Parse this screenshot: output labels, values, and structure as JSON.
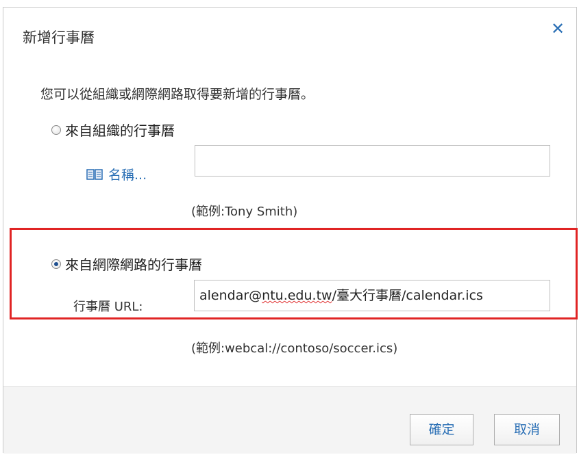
{
  "dialog": {
    "title": "新增行事曆",
    "close_symbol": "✕"
  },
  "intro_text": "您可以從組織或網際網路取得要新增的行事曆。",
  "org_option": {
    "label": "來自組織的行事曆",
    "checked": false,
    "names_button_label": "名稱...",
    "names_icon": "address-book-icon",
    "name_input_value": "",
    "example": "(範例:Tony Smith)"
  },
  "internet_option": {
    "label": "來自網際網路的行事曆",
    "checked": true,
    "url_label": "行事曆 URL:",
    "url_value_part1": "alendar@",
    "url_value_part2": "ntu.edu.tw",
    "url_value_part3": "/臺大行事曆/calendar.ics",
    "example": "(範例:webcal://contoso/soccer.ics)"
  },
  "buttons": {
    "ok_label": "確定",
    "cancel_label": "取消"
  },
  "colors": {
    "accent": "#2a6fb5",
    "highlight": "#e02424"
  }
}
